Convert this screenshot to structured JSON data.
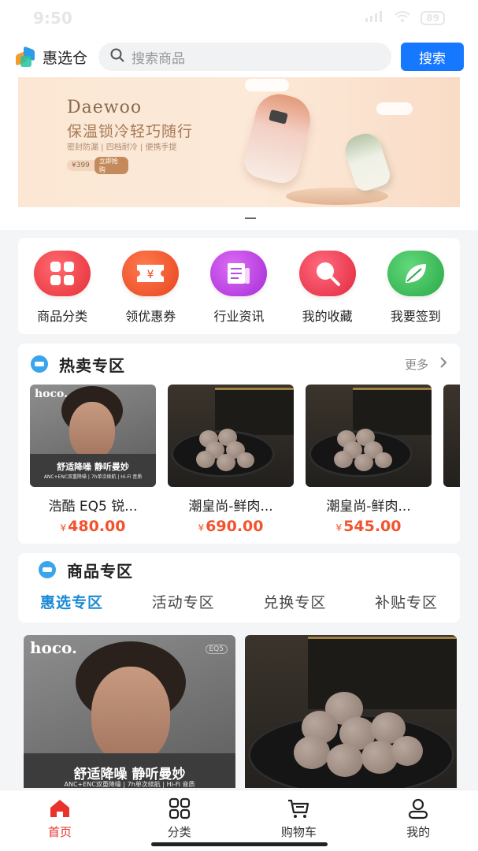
{
  "status": {
    "time": "9:50",
    "battery": "89"
  },
  "header": {
    "app_name": "惠选仓",
    "search_placeholder": "搜索商品",
    "search_button": "搜索"
  },
  "banner": {
    "brand": "Daewoo",
    "slogan": "保温锁冷轻巧随行",
    "features": "密封防漏 | 四档耐冷 | 便携手提",
    "price": "¥399",
    "cta": "立即抢购"
  },
  "quick_menu": [
    {
      "label": "商品分类",
      "icon": "grid-icon",
      "color": "#f0434a"
    },
    {
      "label": "领优惠券",
      "icon": "coupon-icon",
      "color": "#f2552d"
    },
    {
      "label": "行业资讯",
      "icon": "news-icon",
      "color": "#c342e8"
    },
    {
      "label": "我的收藏",
      "icon": "search-heart-icon",
      "color": "#ef3d55"
    },
    {
      "label": "我要签到",
      "icon": "leaf-icon",
      "color": "#3fbf5a"
    }
  ],
  "hot_section": {
    "title": "热卖专区",
    "more": "更多",
    "items": [
      {
        "name": "浩酷 EQ5 锐...",
        "currency": "¥",
        "price": "480.00",
        "image": "hoco"
      },
      {
        "name": "潮皇尚-鲜肉...",
        "currency": "¥",
        "price": "690.00",
        "image": "meat"
      },
      {
        "name": "潮皇尚-鲜肉...",
        "currency": "¥",
        "price": "545.00",
        "image": "meat"
      }
    ]
  },
  "hoco_image": {
    "brand": "hoco.",
    "caption": "舒适降噪 静听曼妙",
    "sub": "ANC+ENC双重降噪 | 7h单次续航 | Hi-Fi 音质",
    "model": "EQ5"
  },
  "goods_section": {
    "title": "商品专区",
    "tabs": [
      "惠选专区",
      "活动专区",
      "兑换专区",
      "补贴专区"
    ],
    "active_tab": 0
  },
  "tabbar": [
    {
      "label": "首页",
      "icon": "home-icon",
      "active": true
    },
    {
      "label": "分类",
      "icon": "category-icon",
      "active": false
    },
    {
      "label": "购物车",
      "icon": "cart-icon",
      "active": false
    },
    {
      "label": "我的",
      "icon": "profile-icon",
      "active": false
    }
  ],
  "colors": {
    "accent": "#1677ff",
    "price": "#f2532d",
    "active_tab": "#1a8ad6",
    "home_active": "#e8322b"
  }
}
